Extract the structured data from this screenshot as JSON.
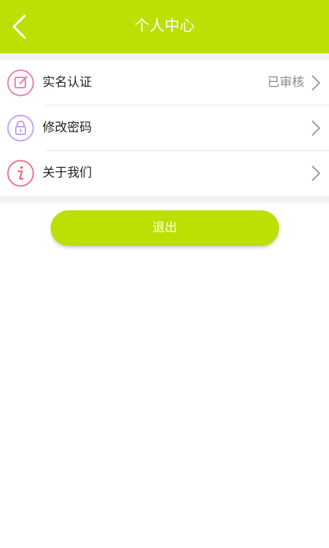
{
  "colors": {
    "header_bg": "#bcdf04",
    "button_bg": "#bcdf04",
    "pink_icon": "#f07ba6",
    "purple_icon": "#c79af0",
    "red_icon": "#ee6c86"
  },
  "header": {
    "title": "个人中心",
    "back_icon": "chevron-left-icon"
  },
  "menu": {
    "items": [
      {
        "label": "实名认证",
        "value": "已审核",
        "icon": "edit-icon"
      },
      {
        "label": "修改密码",
        "value": "",
        "icon": "lock-icon"
      },
      {
        "label": "关于我们",
        "value": "",
        "icon": "info-icon"
      }
    ]
  },
  "actions": {
    "logout_label": "退出"
  }
}
